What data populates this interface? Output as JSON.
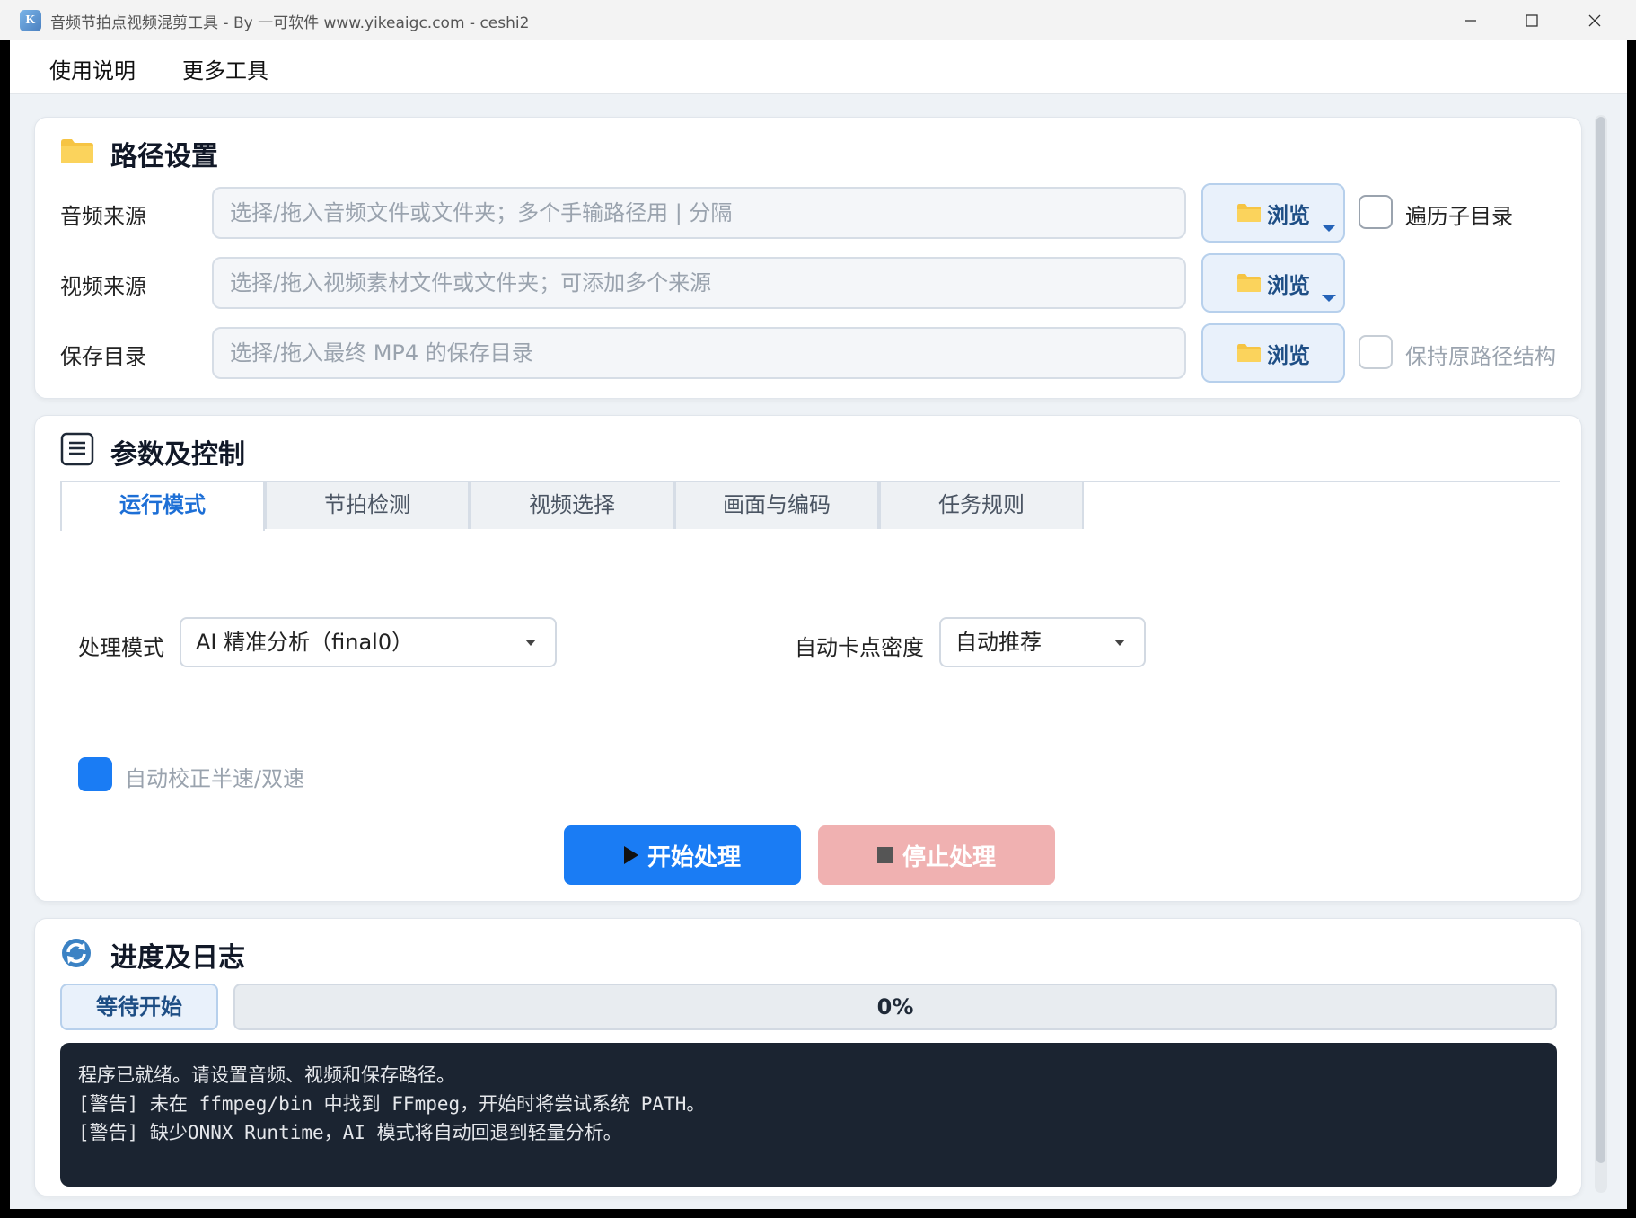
{
  "window": {
    "title": "音频节拍点视频混剪工具 - By 一可软件 www.yikeaigc.com - ceshi2",
    "app_icon_letter": "K"
  },
  "menu": {
    "items": [
      {
        "label": "使用说明"
      },
      {
        "label": "更多工具"
      }
    ]
  },
  "path_settings": {
    "title": "路径设置",
    "icon": "folder-icon",
    "rows": [
      {
        "label": "音频来源",
        "placeholder": "选择/拖入音频文件或文件夹；多个手输路径用 | 分隔",
        "browse_label": "浏览",
        "has_dropdown": true,
        "checkbox_label": "遍历子目录",
        "checkbox_checked": false,
        "checkbox_enabled": true
      },
      {
        "label": "视频来源",
        "placeholder": "选择/拖入视频素材文件或文件夹；可添加多个来源",
        "browse_label": "浏览",
        "has_dropdown": true
      },
      {
        "label": "保存目录",
        "placeholder": "选择/拖入最终 MP4 的保存目录",
        "browse_label": "浏览",
        "has_dropdown": false,
        "checkbox_label": "保持原路径结构",
        "checkbox_checked": false,
        "checkbox_enabled": false
      }
    ]
  },
  "params": {
    "title": "参数及控制",
    "icon": "list-icon",
    "tabs": [
      {
        "label": "运行模式",
        "active": true
      },
      {
        "label": "节拍检测",
        "active": false
      },
      {
        "label": "视频选择",
        "active": false
      },
      {
        "label": "画面与编码",
        "active": false
      },
      {
        "label": "任务规则",
        "active": false
      }
    ],
    "mode_label": "处理模式",
    "mode_value": "AI 精准分析（final0）",
    "density_label": "自动卡点密度",
    "density_value": "自动推荐",
    "auto_correct_label": "自动校正半速/双速",
    "auto_correct_checked": true,
    "start_label": "开始处理",
    "stop_label": "停止处理"
  },
  "progress": {
    "title": "进度及日志",
    "icon": "refresh-icon",
    "status": "等待开始",
    "percent_value": 0,
    "percent_text": "0%",
    "log": "程序已就绪。请设置音频、视频和保存路径。\n[警告] 未在 ffmpeg/bin 中找到 FFmpeg，开始时将尝试系统 PATH。\n[警告] 缺少ONNX Runtime，AI 模式将自动回退到轻量分析。"
  },
  "colors": {
    "accent": "#1a7cf4",
    "stop_button": "#f0b1b1",
    "log_background": "#1b2431",
    "browse_text": "#1e4e85"
  }
}
